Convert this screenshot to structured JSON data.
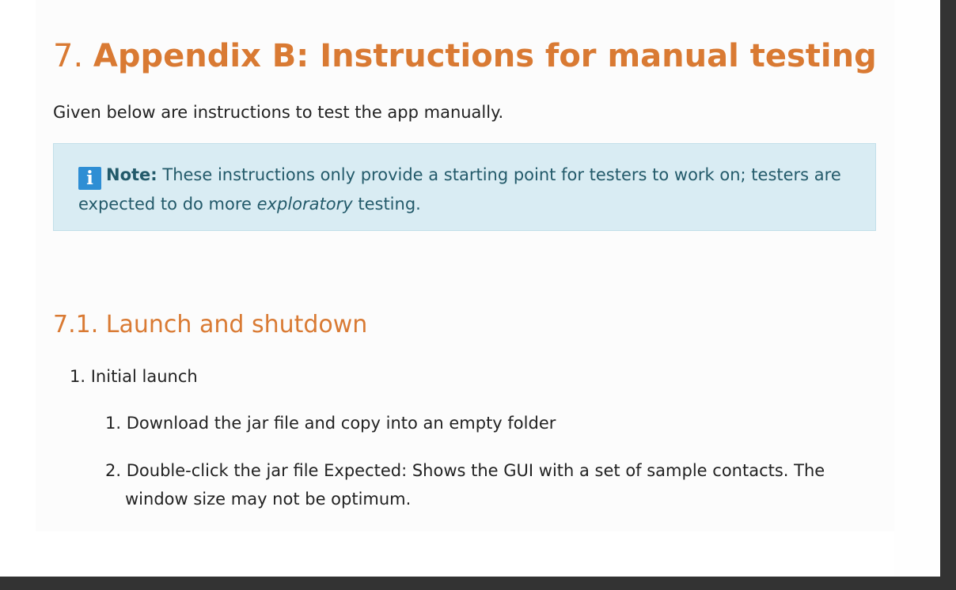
{
  "section": {
    "number": "7.",
    "title": "Appendix B: Instructions for manual testing",
    "intro": "Given below are instructions to test the app manually."
  },
  "note": {
    "icon": "info-icon",
    "label": "Note:",
    "text_before": "These instructions only provide a starting point for testers to work on; testers are expected to do more",
    "emphasis": "exploratory",
    "text_after": "testing."
  },
  "subsection": {
    "number": "7.1.",
    "title": "Launch and shutdown"
  },
  "list": {
    "item1": {
      "number": "1.",
      "label": "Initial launch",
      "subitems": [
        {
          "number": "1.",
          "text": "Download the jar file and copy into an empty folder"
        },
        {
          "number": "2.",
          "text": "Double-click the jar file Expected: Shows the GUI with a set of sample contacts. The window size may not be optimum."
        }
      ]
    }
  }
}
